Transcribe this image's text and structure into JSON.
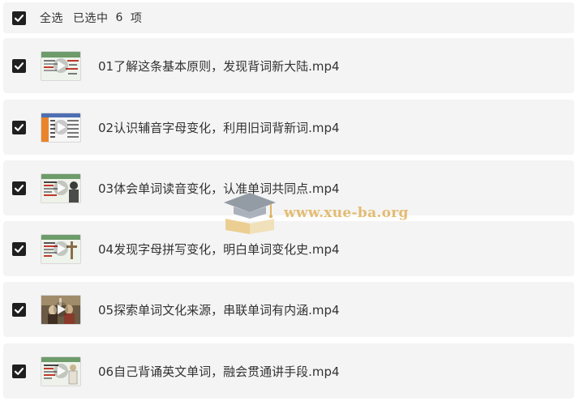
{
  "header": {
    "select_all_label": "全选",
    "selected_prefix": "已选中",
    "selected_count": "6",
    "selected_suffix": "项",
    "checked": true
  },
  "files": [
    {
      "name": "01了解这条基本原则，发现背词新大陆.mp4",
      "checked": true,
      "thumb_style": "green"
    },
    {
      "name": "02认识辅音字母变化，利用旧词背新词.mp4",
      "checked": true,
      "thumb_style": "table"
    },
    {
      "name": "03体会单词读音变化，认准单词共同点.mp4",
      "checked": true,
      "thumb_style": "figure"
    },
    {
      "name": "04发现字母拼写变化，明白单词变化史.mp4",
      "checked": true,
      "thumb_style": "green"
    },
    {
      "name": "05探索单词文化来源，串联单词有内涵.mp4",
      "checked": true,
      "thumb_style": "photo"
    },
    {
      "name": "06自己背诵英文单词，融会贯通讲手段.mp4",
      "checked": true,
      "thumb_style": "figure"
    }
  ],
  "watermark": {
    "text": "www.xue-ba.org",
    "icon": "graduation-cap-book-icon"
  },
  "colors": {
    "row_background": "#f4f4f5",
    "checkbox": "#1f1f1f",
    "text": "#333333",
    "watermark": "#e0b25a"
  }
}
